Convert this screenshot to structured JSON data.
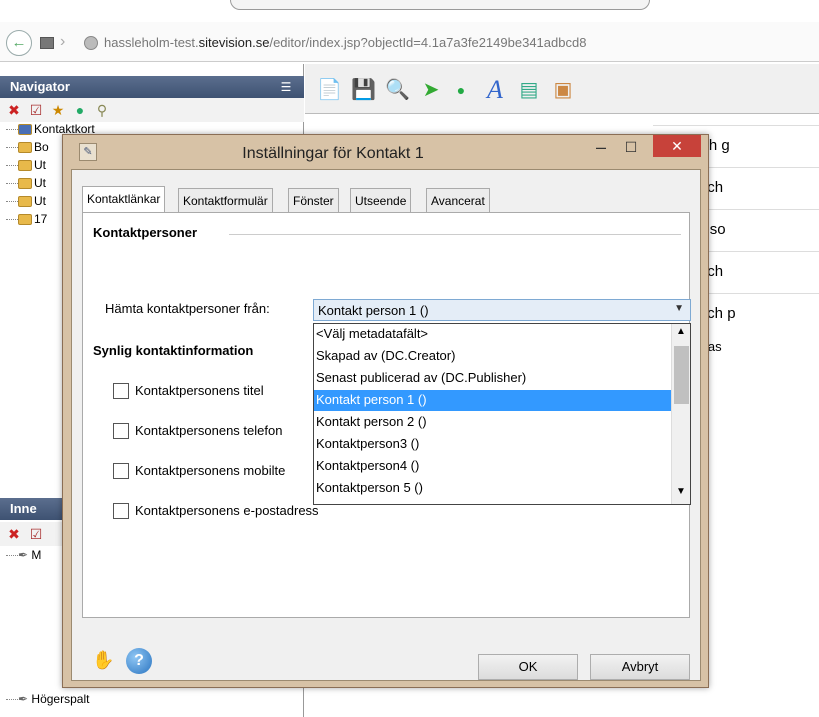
{
  "browser": {
    "url_prefix": "hassleholm-test.",
    "url_domain": "sitevision.se",
    "url_rest": "/editor/index.jsp?objectId=4.1a7a3fe2149be341adbcd8"
  },
  "navigator": {
    "title": "Navigator",
    "tree": [
      "Kontaktkort",
      "Bo",
      "Ut",
      "Ut",
      "Ut",
      "17"
    ]
  },
  "inner_panel": {
    "title": "Inne",
    "tree": [
      "M",
      "Högerspalt"
    ]
  },
  "content_rows": [
    "uleva och g",
    "ga, bo och",
    "ik och reso",
    "ingsliv och",
    "mmun och p"
  ],
  "content_note": "modul visas",
  "dialog": {
    "title": "Inställningar för Kontakt 1",
    "tabs": [
      "Kontaktlänkar",
      "Kontaktformulär",
      "Fönster",
      "Utseende",
      "Avancerat"
    ],
    "group_contacts": "Kontaktpersoner",
    "fetch_label": "Hämta kontaktpersoner från:",
    "select_value": "Kontakt person 1 ()",
    "options": [
      "<Välj metadatafält>",
      "Skapad av (DC.Creator)",
      "Senast publicerad av (DC.Publisher)",
      "Kontakt person 1 ()",
      "Kontakt person 2 ()",
      "Kontaktperson3 ()",
      "Kontaktperson4 ()",
      "Kontaktperson 5 ()"
    ],
    "selected_option_index": 3,
    "group_visible": "Synlig kontaktinformation",
    "checkboxes": [
      "Kontaktpersonens titel",
      "Kontaktpersonens telefon",
      "Kontaktpersonens mobilte",
      "Kontaktpersonens e-postadress"
    ],
    "ok_label": "OK",
    "cancel_label": "Avbryt"
  }
}
